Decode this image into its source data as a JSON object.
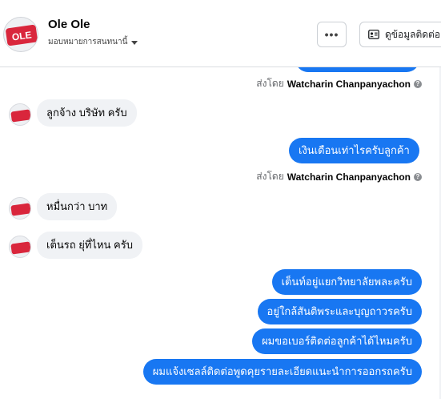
{
  "header": {
    "name": "Ole Ole",
    "assign_label": "มอบหมายการสนทนานี้",
    "more_label": "•••",
    "contact_label": "ดูข้อมูลติดต่อ",
    "avatar_text": "OLE"
  },
  "sender_name": "Watcharin Chanpanyachon",
  "sent_by_prefix": "ส่งโดย",
  "messages": {
    "m1": "ลูกจ้าง บริษัท ครับ",
    "m2": "เงินเดือนเท่าไรครับลูกค้า",
    "m3": "หมื่นกว่า บาท",
    "m4": "เต็นรถ ยุ่ที่ไหน ครับ",
    "m5": "เต็นท์อยู่แยกวิทยาลัยพละครับ",
    "m6": "อยู่ใกล้สันติพระและบุญถาวรครับ",
    "m7": "ผมขอเบอร์ติดต่อลูกค้าได้ไหมครับ",
    "m8": "ผมแจ้งเซลล์ติดต่อพูดคุยรายละเอียดแนะนำการออกรถครับ"
  },
  "colors": {
    "outgoing": "#1877f2",
    "incoming": "#f0f2f5",
    "brand_avatar": "#d9263c"
  },
  "icons": {
    "caret": "chevron-down-icon",
    "contact": "contact-card-icon",
    "info": "info-icon"
  }
}
